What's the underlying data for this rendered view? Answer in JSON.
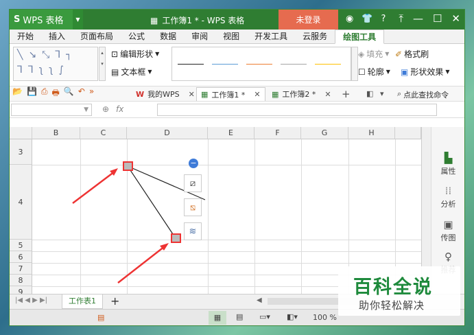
{
  "titlebar": {
    "app_name": "WPS 表格",
    "doc_title": "工作簿1 * - WPS 表格",
    "login_label": "未登录",
    "help_label": "?"
  },
  "ribbon_tabs": [
    "开始",
    "插入",
    "页面布局",
    "公式",
    "数据",
    "审阅",
    "视图",
    "开发工具",
    "云服务",
    "绘图工具"
  ],
  "ribbon": {
    "edit_shape_label": "编辑形状",
    "textbox_label": "文本框",
    "fill_label": "填充",
    "format_brush_label": "格式刷",
    "outline_label": "轮廓",
    "shape_effect_label": "形状效果",
    "line_colors": [
      "#222222",
      "#5b9bd5",
      "#ed7d31",
      "#a5a5a5",
      "#ffc000"
    ]
  },
  "doc_tabs": {
    "mywps_label": "我的WPS",
    "book1_label": "工作簿1 *",
    "book2_label": "工作簿2 *",
    "search_label": "点此查找命令"
  },
  "formula_bar": {
    "fx_label": "fx"
  },
  "columns": [
    "B",
    "C",
    "D",
    "E",
    "F",
    "G",
    "H"
  ],
  "rows": [
    "3",
    "4",
    "5",
    "6",
    "7",
    "8",
    "9"
  ],
  "sidebar": {
    "props_label": "属性",
    "analysis_label": "分析",
    "share_label": "传图",
    "recommend_label": "推荐"
  },
  "sheet": {
    "tab_label": "工作表1",
    "add_label": "+"
  },
  "status": {
    "zoom_label": "100 %"
  },
  "watermark": {
    "title": "百科全说",
    "subtitle": "助你轻松解决"
  }
}
